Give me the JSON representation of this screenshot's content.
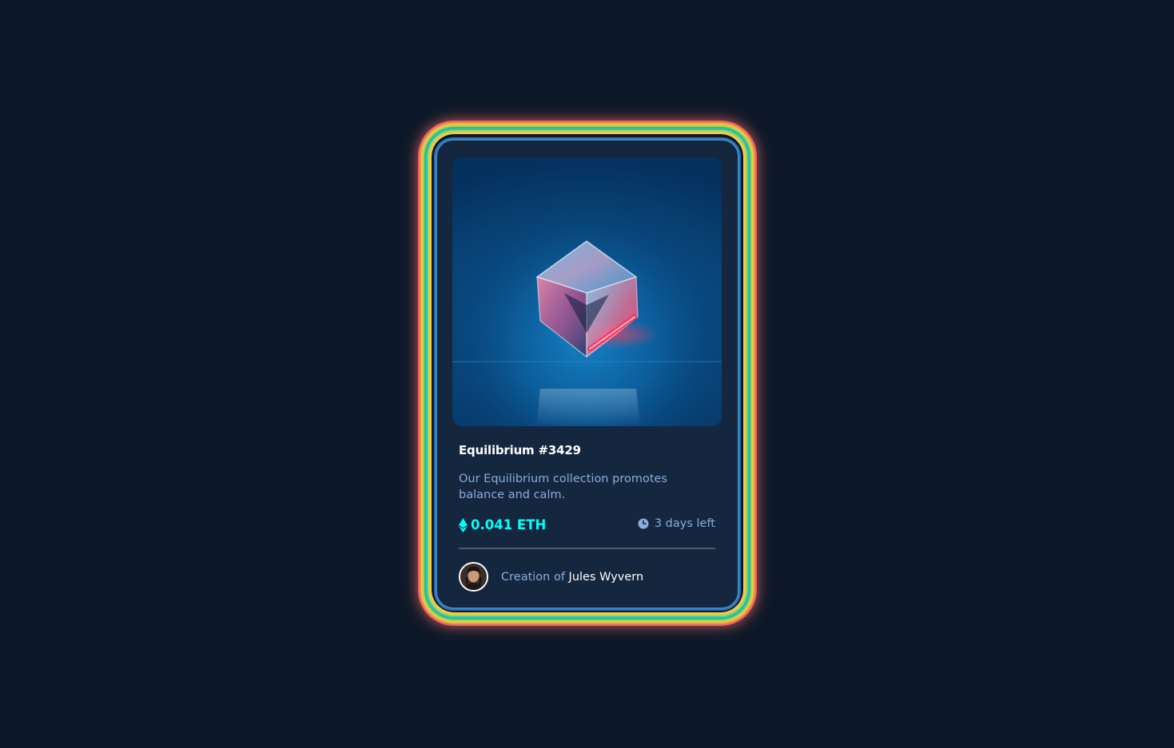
{
  "card": {
    "title": "Equilibrium #3429",
    "description": "Our Equilibrium collection promotes balance and calm.",
    "price": "0.041 ETH",
    "time_left": "3 days left",
    "creator_prefix": "Creation of",
    "creator_name": "Jules Wyvern"
  },
  "icons": {
    "price": "ethereum-icon",
    "time": "clock-icon"
  },
  "colors": {
    "page_background": "#0d1829",
    "card_background": "#15263f",
    "accent_cyan": "#00fff8",
    "soft_blue_text": "#8bacda",
    "white_text": "#ffffff",
    "divider": "#4d5c70"
  }
}
